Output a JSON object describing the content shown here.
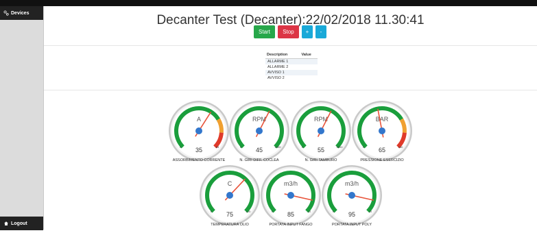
{
  "sidebar": {
    "devices_label": "Devices",
    "logout_label": "Logout"
  },
  "header": {
    "title": "Decanter Test (Decanter):22/02/2018 11.30:41"
  },
  "controls": {
    "start_label": "Start",
    "stop_label": "Stop",
    "plus_label": "+",
    "minus_label": "-"
  },
  "alarms": {
    "headers": [
      "Description",
      "Value"
    ],
    "rows": [
      {
        "description": "ALLARME 1",
        "value": ""
      },
      {
        "description": "ALLARME 2",
        "value": ""
      },
      {
        "description": "AVVISO 1",
        "value": ""
      },
      {
        "description": "AVVISO 2",
        "value": ""
      }
    ]
  },
  "colors": {
    "green": "#1a9e3c",
    "orange": "#f0a030",
    "red": "#e03a2a",
    "needle": "#e8533a",
    "hub": "#3377cc",
    "start": "#27a74a",
    "stop": "#dc3545",
    "info": "#19a9d8"
  },
  "gauges": [
    {
      "unit": "A",
      "value": 35,
      "min": 0,
      "max": 65,
      "min_label": "0",
      "max_label": "65",
      "needle": 0.62,
      "orange": true,
      "label": "ASSORBIMENTO CORRENTE"
    },
    {
      "unit": "RPM",
      "value": 45,
      "min": 0,
      "max": 1000,
      "min_label": "0",
      "max_label": "1000",
      "needle": 0.6,
      "orange": false,
      "label": "N. GIRI DIFF. COCLEA"
    },
    {
      "unit": "RPM",
      "value": 55,
      "min": 0,
      "max": 3300,
      "min_label": "0",
      "max_label": "3300",
      "needle": 0.6,
      "orange": false,
      "label": "N. GIRI TAMBURO"
    },
    {
      "unit": "BAR",
      "value": 65,
      "min": 0,
      "max": 160,
      "min_label": "0",
      "max_label": "160",
      "needle": 0.46,
      "orange": true,
      "label": "PRESSIONE ESERCIZIO"
    },
    {
      "unit": "C",
      "value": 75,
      "min": 0,
      "max": 120,
      "min_label": "0",
      "max_label": "120",
      "needle": 0.66,
      "orange": false,
      "label": "TEMPERATURA OLIO"
    },
    {
      "unit": "m3/h",
      "value": 85,
      "min": 0,
      "max": 10,
      "min_label": "0",
      "max_label": "10",
      "needle": 0.88,
      "orange": false,
      "label": "PORTATA INPUT FANGO"
    },
    {
      "unit": "m3/h",
      "value": 95,
      "min": 0,
      "max": 10,
      "min_label": "0",
      "max_label": "10",
      "needle": 0.88,
      "orange": false,
      "label": "PORTATA INPUT POLY"
    }
  ]
}
